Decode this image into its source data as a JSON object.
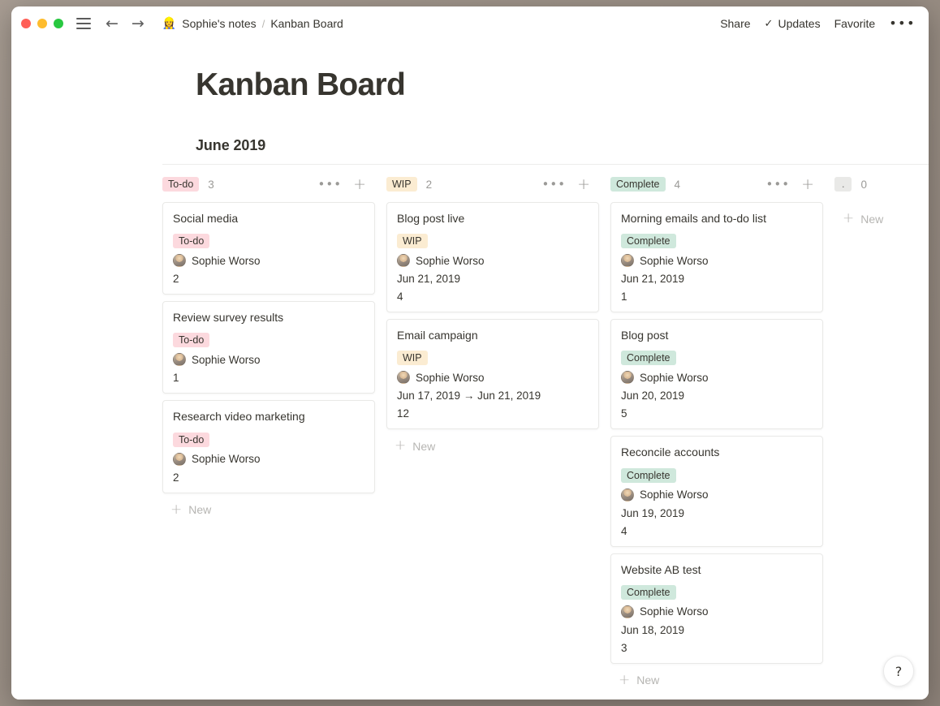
{
  "window": {
    "traffic_lights": [
      "close",
      "minimize",
      "maximize"
    ],
    "colors": {
      "close": "#ff5f57",
      "minimize": "#febc2e",
      "maximize": "#28c840",
      "tag_todo_bg": "#fcd9de",
      "tag_wip_bg": "#fbecd2",
      "tag_complete_bg": "#cfe8dc",
      "tag_empty_bg": "#e9e9e7",
      "text": "#37352f",
      "muted": "#9b9a97"
    }
  },
  "titlebar": {
    "menu_icon": "hamburger-icon",
    "back_icon": "←",
    "forward_icon": "→",
    "breadcrumb": {
      "workspace_emoji": "👷‍♀️",
      "workspace": "Sophie's notes",
      "separator": "/",
      "page": "Kanban Board"
    },
    "share_label": "Share",
    "updates_label": "Updates",
    "updates_check": "✓",
    "favorite_label": "Favorite",
    "more_label": "•••"
  },
  "page": {
    "title": "Kanban Board",
    "board_heading": "June 2019"
  },
  "board": {
    "add_icon": "+",
    "menu_icon": "•••",
    "new_label": "New",
    "new_icon": "+",
    "columns": [
      {
        "id": "todo",
        "tag": "To-do",
        "tag_style": "todo",
        "count": "3",
        "has_new": true,
        "cards": [
          {
            "title": "Social media",
            "tag": "To-do",
            "tag_style": "todo",
            "person": "Sophie Worso",
            "date": "",
            "number": "2"
          },
          {
            "title": "Review survey results",
            "tag": "To-do",
            "tag_style": "todo",
            "person": "Sophie Worso",
            "date": "",
            "number": "1"
          },
          {
            "title": "Research video marketing",
            "tag": "To-do",
            "tag_style": "todo",
            "person": "Sophie Worso",
            "date": "",
            "number": "2"
          }
        ]
      },
      {
        "id": "wip",
        "tag": "WIP",
        "tag_style": "wip",
        "count": "2",
        "has_new": true,
        "cards": [
          {
            "title": "Blog post live",
            "tag": "WIP",
            "tag_style": "wip",
            "person": "Sophie Worso",
            "date": "Jun 21, 2019",
            "number": "4"
          },
          {
            "title": "Email campaign",
            "tag": "WIP",
            "tag_style": "wip",
            "person": "Sophie Worso",
            "date": "Jun 17, 2019 → Jun 21, 2019",
            "number": "12"
          }
        ]
      },
      {
        "id": "complete",
        "tag": "Complete",
        "tag_style": "complete",
        "count": "4",
        "has_new": true,
        "cards": [
          {
            "title": "Morning emails and to-do list",
            "tag": "Complete",
            "tag_style": "complete",
            "person": "Sophie Worso",
            "date": "Jun 21, 2019",
            "number": "1"
          },
          {
            "title": "Blog post",
            "tag": "Complete",
            "tag_style": "complete",
            "person": "Sophie Worso",
            "date": "Jun 20, 2019",
            "number": "5"
          },
          {
            "title": "Reconcile accounts",
            "tag": "Complete",
            "tag_style": "complete",
            "person": "Sophie Worso",
            "date": "Jun 19, 2019",
            "number": "4"
          },
          {
            "title": "Website AB test",
            "tag": "Complete",
            "tag_style": "complete",
            "person": "Sophie Worso",
            "date": "Jun 18, 2019",
            "number": "3"
          }
        ]
      },
      {
        "id": "uncategorized",
        "tag": ".",
        "tag_style": "empty",
        "count": "0",
        "has_new": true,
        "hide_actions": true,
        "cards": []
      }
    ]
  },
  "help": {
    "label": "?"
  }
}
